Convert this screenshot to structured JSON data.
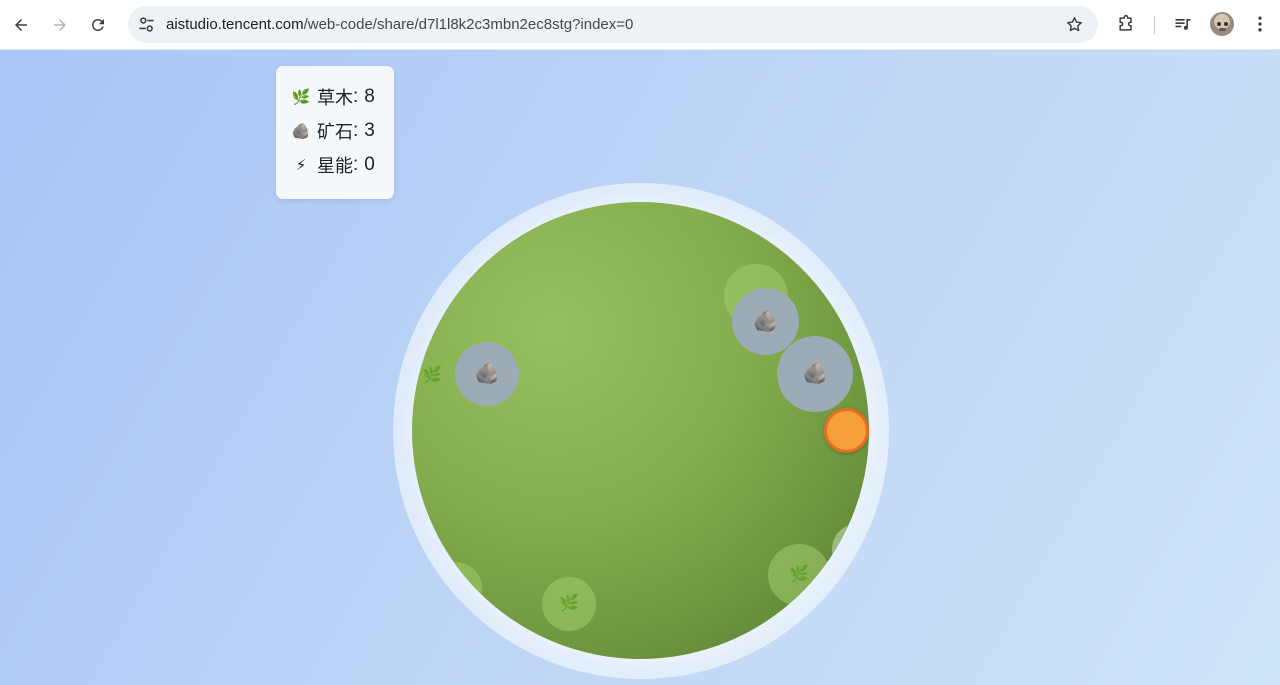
{
  "browser": {
    "url_host": "aistudio.tencent.com",
    "url_path": "/web-code/share/d7l1l8k2c3mbn2ec8stg?index=0"
  },
  "resources": {
    "grass": {
      "icon": "🌿",
      "label": "草木",
      "value": "8"
    },
    "ore": {
      "icon": "🪨",
      "label": "矿石",
      "value": "3"
    },
    "star": {
      "icon": "⚡",
      "label": "星能",
      "value": "0"
    }
  },
  "icons": {
    "grass": "🌿",
    "ore": "🪨"
  },
  "colors": {
    "planet": "#84ad4d",
    "ore_spot": "#9cabb6",
    "player": "#f6a03a",
    "player_border": "#e46f22"
  }
}
